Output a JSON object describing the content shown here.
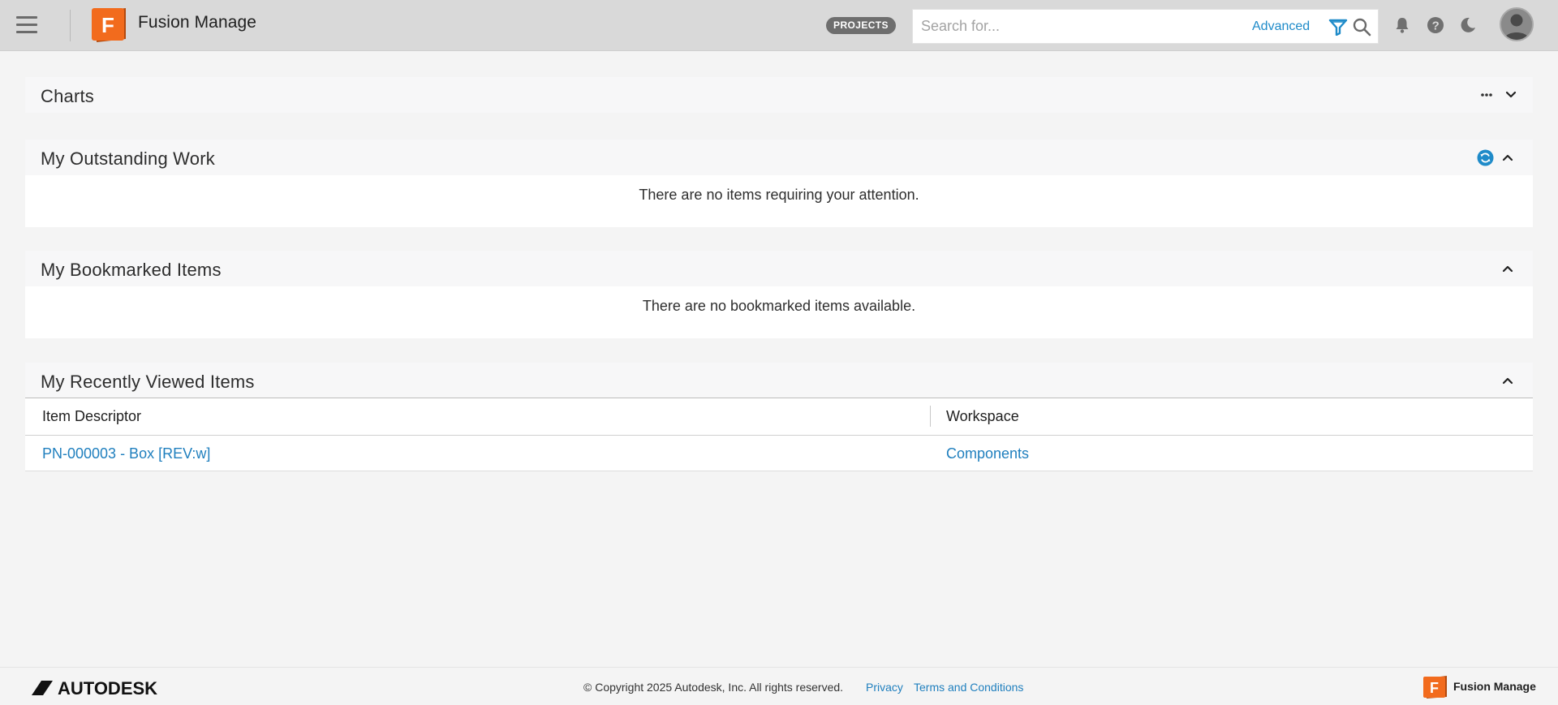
{
  "header": {
    "app_name": "Fusion Manage",
    "logo_letter": "F",
    "projects_label": "PROJECTS",
    "search_placeholder": "Search for...",
    "search_value": "",
    "advanced_label": "Advanced",
    "icons": [
      "menu-icon",
      "filter-icon",
      "search-icon",
      "bell-icon",
      "help-icon",
      "moon-icon",
      "avatar"
    ],
    "accent_color": "#1f8bc9"
  },
  "panels": {
    "charts": {
      "title": "Charts"
    },
    "outstanding_work": {
      "title": "My Outstanding Work",
      "empty_message": "There are no items requiring your attention."
    },
    "bookmarks": {
      "title": "My Bookmarked Items",
      "empty_message": "There are no bookmarked items available."
    },
    "recent": {
      "title": "My Recently Viewed Items",
      "columns": [
        "Item Descriptor",
        "Workspace"
      ],
      "rows": [
        {
          "item": "PN-000003 - Box [REV:w]",
          "workspace": "Components"
        }
      ]
    }
  },
  "footer": {
    "company": "AUTODESK",
    "copyright": "© Copyright 2025 Autodesk, Inc. All rights reserved.",
    "privacy": "Privacy",
    "terms": "Terms and Conditions",
    "brand": "Fusion Manage",
    "logo_letter": "F"
  },
  "colors": {
    "brand_orange": "#f26b1d",
    "link_blue": "#1f7fbe",
    "refresh_blue": "#1f8bc9"
  }
}
